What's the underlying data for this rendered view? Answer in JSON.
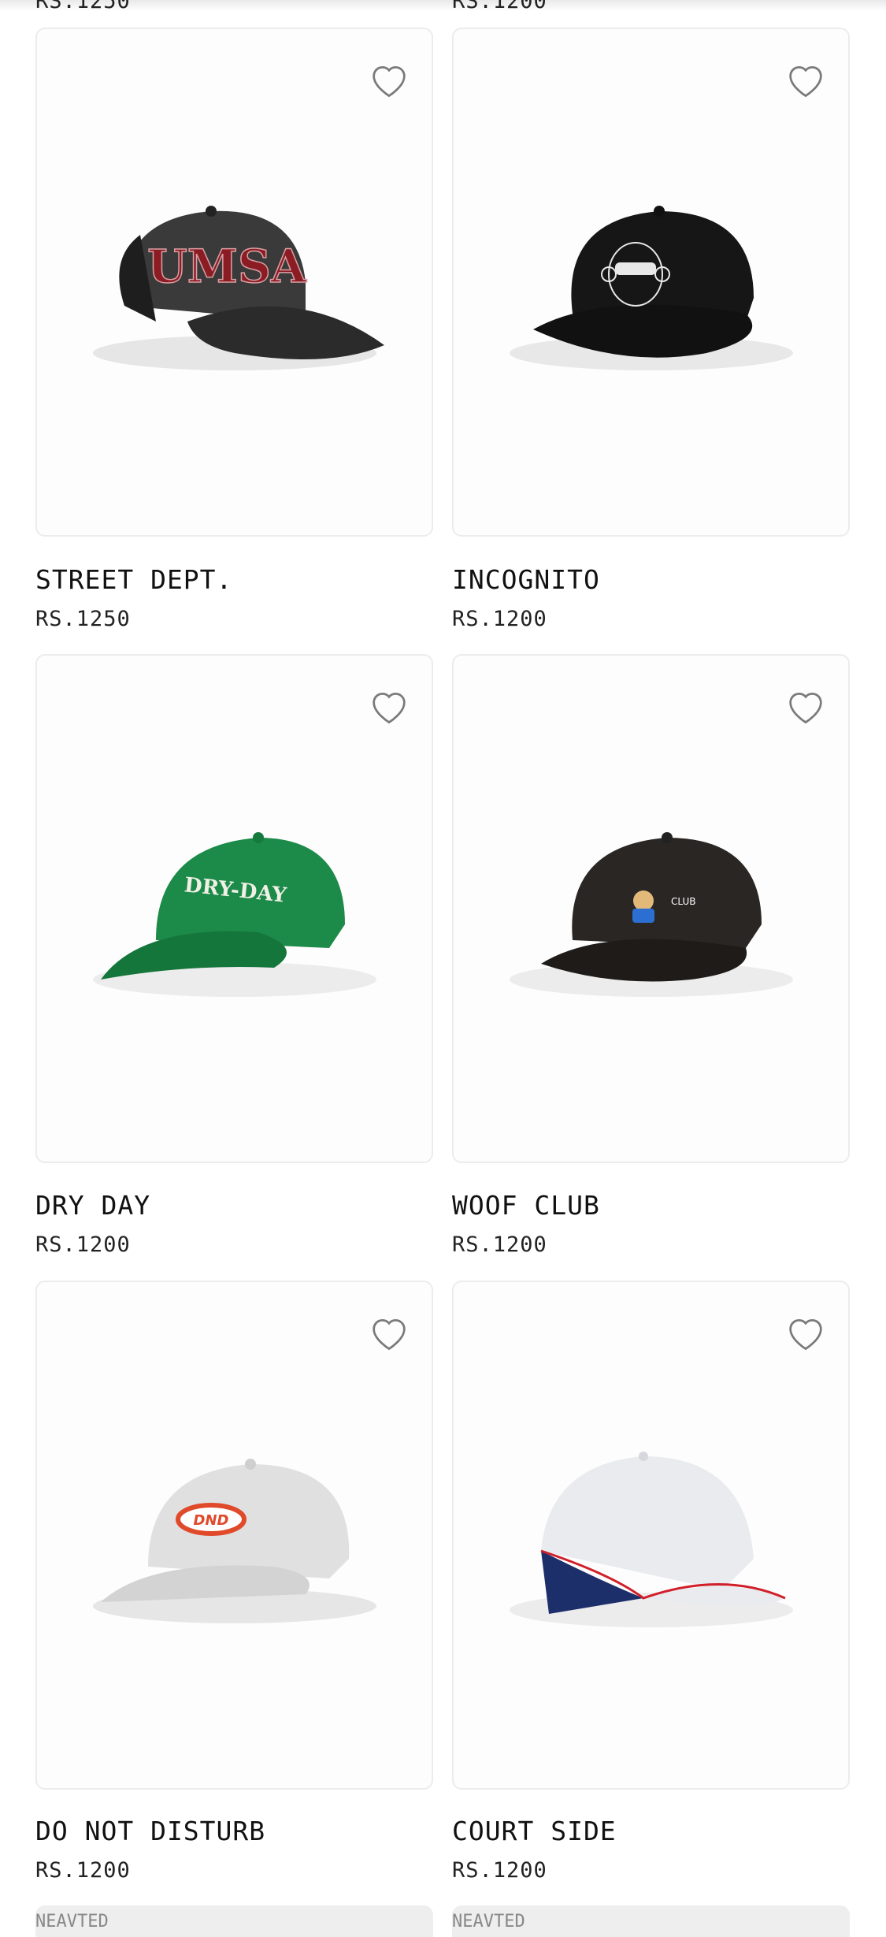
{
  "top_partial": {
    "left_price": "RS.1250",
    "right_price": "RS.1200"
  },
  "products": [
    {
      "name": "STREET DEPT.",
      "price": "RS.1250",
      "icon": "black-cap-red-gothic-logo"
    },
    {
      "name": "INCOGNITO",
      "price": "RS.1200",
      "icon": "black-cap-monkey-logo"
    },
    {
      "name": "DRY DAY",
      "price": "RS.1200",
      "icon": "green-cap-dry-day-text"
    },
    {
      "name": "WOOF CLUB",
      "price": "RS.1200",
      "icon": "black-cap-dog-patch"
    },
    {
      "name": "DO NOT DISTURB",
      "price": "RS.1200",
      "icon": "white-cap-dnd-patch"
    },
    {
      "name": "COURT SIDE",
      "price": "RS.1200",
      "icon": "white-navy-cap-red-piping"
    }
  ],
  "cap_text": {
    "street": "UMSA",
    "dry_day": "DRY-DAY",
    "dnd": "DND",
    "woof_club": "CLUB"
  },
  "bottom_partial": {
    "left_label": "NEAVTED",
    "right_label": "NEAVTED"
  },
  "colors": {
    "heart_outline": "#7a7a7a",
    "card_border": "#ececec",
    "text": "#111111"
  }
}
